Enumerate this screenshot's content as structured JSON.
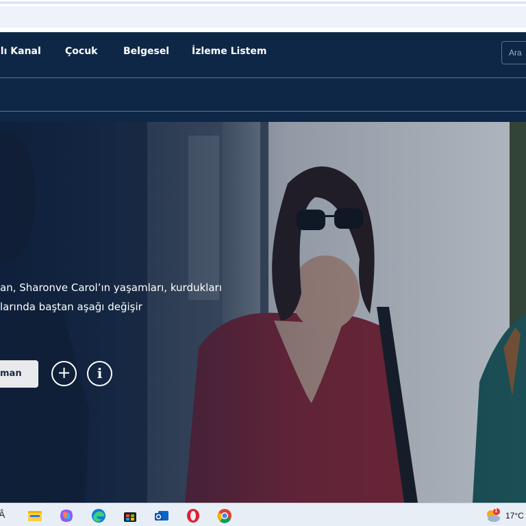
{
  "nav": {
    "items": [
      {
        "label": "ılı Kanal"
      },
      {
        "label": "Çocuk"
      },
      {
        "label": "Belgesel"
      },
      {
        "label": "İzleme Listem"
      }
    ],
    "search_placeholder": "Ara"
  },
  "hero": {
    "description_line1": "an, Sharonve Carol’ın yaşamları, kurdukları",
    "description_line2": "larında baştan aşağı değişir",
    "watch_label": "man",
    "add_glyph": "+",
    "info_glyph": "i"
  },
  "taskbar": {
    "left_glyph": "Â",
    "temperature": "17°C",
    "notification_count": "1",
    "icons": [
      "file-explorer-icon",
      "copilot-icon",
      "edge-icon",
      "store-icon",
      "outlook-icon",
      "opera-icon",
      "chrome-icon"
    ]
  },
  "colors": {
    "nav_bg": "#0f2747",
    "button_bg": "#e9eaec"
  }
}
